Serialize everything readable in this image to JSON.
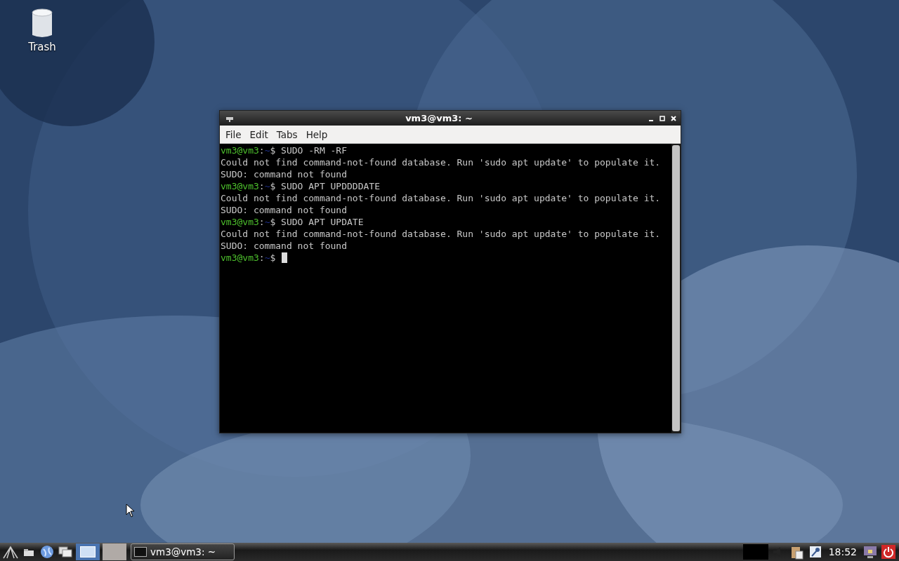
{
  "desktop_icons": [
    {
      "label": "Trash"
    }
  ],
  "window": {
    "title": "vm3@vm3: ~",
    "menu": [
      "File",
      "Edit",
      "Tabs",
      "Help"
    ],
    "lines": [
      {
        "kind": "prompt",
        "user": "vm3@vm3",
        "sep": ":",
        "path": "~",
        "command": "$ SUDO -RM -RF"
      },
      {
        "kind": "output",
        "text": "Could not find command-not-found database. Run 'sudo apt update' to populate it."
      },
      {
        "kind": "output",
        "text": "SUDO: command not found"
      },
      {
        "kind": "prompt",
        "user": "vm3@vm3",
        "sep": ":",
        "path": "~",
        "command": "$ SUDO APT UPDDDDATE"
      },
      {
        "kind": "output",
        "text": "Could not find command-not-found database. Run 'sudo apt update' to populate it."
      },
      {
        "kind": "output",
        "text": "SUDO: command not found"
      },
      {
        "kind": "prompt",
        "user": "vm3@vm3",
        "sep": ":",
        "path": "~",
        "command": "$ SUDO APT UPDATE"
      },
      {
        "kind": "output",
        "text": "Could not find command-not-found database. Run 'sudo apt update' to populate it."
      },
      {
        "kind": "output",
        "text": "SUDO: command not found"
      },
      {
        "kind": "prompt",
        "user": "vm3@vm3",
        "sep": ":",
        "path": "~",
        "command": "$",
        "cursor": true
      }
    ]
  },
  "taskbar": {
    "workspaces": [
      {
        "selected": true
      },
      {
        "selected": false
      }
    ],
    "tasks": [
      {
        "label": "vm3@vm3: ~",
        "selected": false
      }
    ],
    "clock": "18:52"
  }
}
